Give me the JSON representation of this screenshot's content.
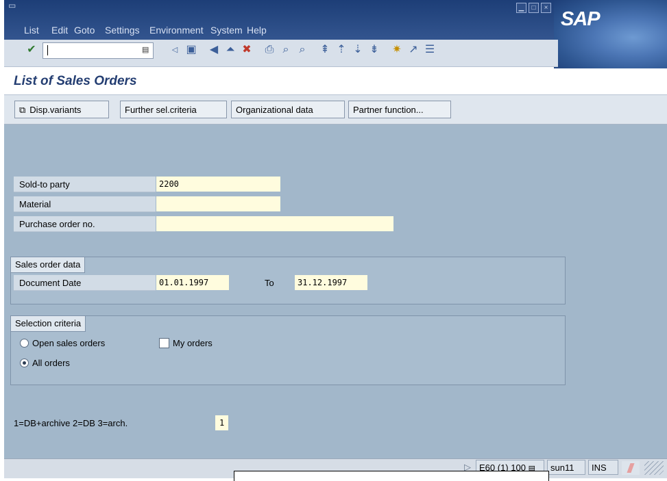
{
  "menu": [
    "List",
    "Edit",
    "Goto",
    "Settings",
    "Environment",
    "System",
    "Help"
  ],
  "brand": "SAP",
  "title": "List of Sales Orders",
  "app_toolbar": {
    "disp_variants": "Disp.variants",
    "further_sel": "Further sel.criteria",
    "org_data": "Organizational data",
    "partner_function": "Partner function..."
  },
  "fields": {
    "sold_to_party": {
      "label": "Sold-to party",
      "value": "2200"
    },
    "material": {
      "label": "Material",
      "value": ""
    },
    "purchase_order_no": {
      "label": "Purchase order no.",
      "value": ""
    }
  },
  "sales_order_data": {
    "title": "Sales order data",
    "document_date_label": "Document Date",
    "from": "01.01.1997",
    "to_label": "To",
    "to": "31.12.1997"
  },
  "selection_criteria": {
    "title": "Selection criteria",
    "open_orders": "Open sales orders",
    "my_orders": "My orders",
    "all_orders": "All orders",
    "selected": "all_orders"
  },
  "archive": {
    "label": "1=DB+archive 2=DB 3=arch.",
    "value": "1"
  },
  "status_bar": {
    "system": "E60 (1) 100",
    "server": "sun11",
    "mode": "INS"
  },
  "colors": {
    "menu_bg": "#1d3e77",
    "work_area": "#a2b7ca",
    "input_bg": "#fffcde",
    "title_text": "#243e72"
  }
}
